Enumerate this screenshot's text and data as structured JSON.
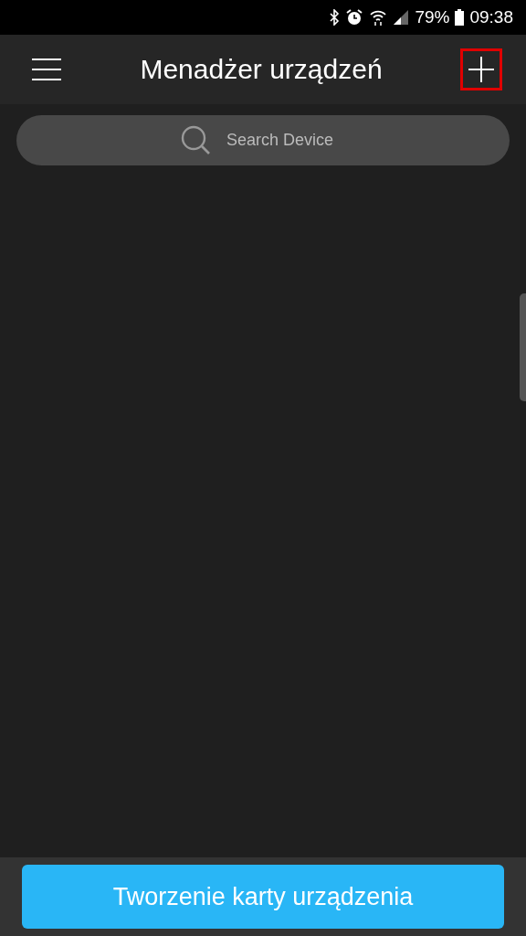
{
  "status_bar": {
    "battery": "79%",
    "time": "09:38"
  },
  "header": {
    "title": "Menadżer urządzeń",
    "add_button": {
      "highlighted": true
    }
  },
  "search": {
    "placeholder": "Search Device"
  },
  "bottom_button": {
    "label": "Tworzenie karty urządzenia"
  }
}
